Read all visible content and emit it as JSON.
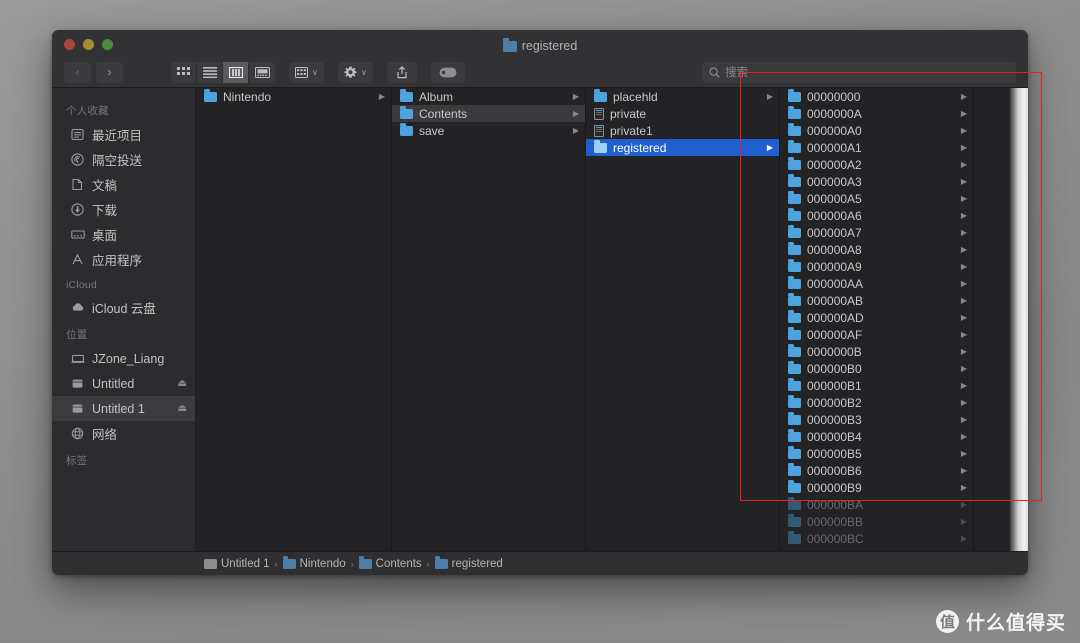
{
  "window": {
    "title": "registered",
    "title_icon": "folder-icon",
    "traffic_lights": [
      "close-button",
      "minimize-button",
      "zoom-button"
    ]
  },
  "toolbar": {
    "back_label": "‹",
    "forward_label": "›",
    "view_modes": [
      {
        "name": "icon-view",
        "active": false
      },
      {
        "name": "list-view",
        "active": false
      },
      {
        "name": "column-view",
        "active": true
      },
      {
        "name": "gallery-view",
        "active": false
      }
    ],
    "group_button": "grid-icon",
    "action_button": "gear-icon",
    "share_button": "share-icon",
    "tag_button": "tag-icon",
    "chevron": "∨"
  },
  "search": {
    "icon": "search-icon",
    "placeholder": "搜索",
    "value": ""
  },
  "sidebar": {
    "sections": [
      {
        "header": "个人收藏",
        "items": [
          {
            "label": "最近项目",
            "icon": "clock-recent-icon",
            "glyph": "☲",
            "selected": false,
            "eject": false
          },
          {
            "label": "隔空投送",
            "icon": "airdrop-icon",
            "glyph": "◎",
            "selected": false,
            "eject": false
          },
          {
            "label": "文稿",
            "icon": "documents-icon",
            "glyph": "☷",
            "selected": false,
            "eject": false
          },
          {
            "label": "下载",
            "icon": "downloads-icon",
            "glyph": "⬇",
            "selected": false,
            "eject": false
          },
          {
            "label": "桌面",
            "icon": "desktop-icon",
            "glyph": "▭",
            "selected": false,
            "eject": false
          },
          {
            "label": "应用程序",
            "icon": "applications-icon",
            "glyph": "Λ",
            "selected": false,
            "eject": false
          }
        ]
      },
      {
        "header": "iCloud",
        "items": [
          {
            "label": "iCloud 云盘",
            "icon": "cloud-icon",
            "glyph": "☁",
            "selected": false,
            "eject": false
          }
        ]
      },
      {
        "header": "位置",
        "items": [
          {
            "label": "JZone_Liang",
            "icon": "laptop-icon",
            "glyph": "▭",
            "selected": false,
            "eject": false
          },
          {
            "label": "Untitled",
            "icon": "drive-icon",
            "glyph": "▤",
            "selected": false,
            "eject": true
          },
          {
            "label": "Untitled 1",
            "icon": "drive-icon",
            "glyph": "▤",
            "selected": true,
            "eject": true
          },
          {
            "label": "网络",
            "icon": "network-globe-icon",
            "glyph": "⊕",
            "selected": false,
            "eject": false
          }
        ]
      },
      {
        "header": "标签",
        "items": []
      }
    ],
    "eject_glyph": "⏏"
  },
  "columns": [
    {
      "name": "column-volume",
      "rows": [
        {
          "label": "Nintendo",
          "kind": "folder",
          "arrow": true,
          "state": "none"
        }
      ]
    },
    {
      "name": "column-nintendo",
      "rows": [
        {
          "label": "Album",
          "kind": "folder",
          "arrow": true,
          "state": "none"
        },
        {
          "label": "Contents",
          "kind": "folder",
          "arrow": true,
          "state": "inactive"
        },
        {
          "label": "save",
          "kind": "folder",
          "arrow": true,
          "state": "none"
        }
      ]
    },
    {
      "name": "column-contents",
      "rows": [
        {
          "label": "placehld",
          "kind": "folder",
          "arrow": true,
          "state": "none"
        },
        {
          "label": "private",
          "kind": "file",
          "arrow": false,
          "state": "none"
        },
        {
          "label": "private1",
          "kind": "file",
          "arrow": false,
          "state": "none"
        },
        {
          "label": "registered",
          "kind": "folder",
          "arrow": true,
          "state": "active"
        }
      ]
    },
    {
      "name": "column-registered",
      "rows": [
        {
          "label": "00000000",
          "kind": "folder",
          "arrow": true,
          "state": "none",
          "dim": false
        },
        {
          "label": "0000000A",
          "kind": "folder",
          "arrow": true,
          "state": "none",
          "dim": false
        },
        {
          "label": "000000A0",
          "kind": "folder",
          "arrow": true,
          "state": "none",
          "dim": false
        },
        {
          "label": "000000A1",
          "kind": "folder",
          "arrow": true,
          "state": "none",
          "dim": false
        },
        {
          "label": "000000A2",
          "kind": "folder",
          "arrow": true,
          "state": "none",
          "dim": false
        },
        {
          "label": "000000A3",
          "kind": "folder",
          "arrow": true,
          "state": "none",
          "dim": false
        },
        {
          "label": "000000A5",
          "kind": "folder",
          "arrow": true,
          "state": "none",
          "dim": false
        },
        {
          "label": "000000A6",
          "kind": "folder",
          "arrow": true,
          "state": "none",
          "dim": false
        },
        {
          "label": "000000A7",
          "kind": "folder",
          "arrow": true,
          "state": "none",
          "dim": false
        },
        {
          "label": "000000A8",
          "kind": "folder",
          "arrow": true,
          "state": "none",
          "dim": false
        },
        {
          "label": "000000A9",
          "kind": "folder",
          "arrow": true,
          "state": "none",
          "dim": false
        },
        {
          "label": "000000AA",
          "kind": "folder",
          "arrow": true,
          "state": "none",
          "dim": false
        },
        {
          "label": "000000AB",
          "kind": "folder",
          "arrow": true,
          "state": "none",
          "dim": false
        },
        {
          "label": "000000AD",
          "kind": "folder",
          "arrow": true,
          "state": "none",
          "dim": false
        },
        {
          "label": "000000AF",
          "kind": "folder",
          "arrow": true,
          "state": "none",
          "dim": false
        },
        {
          "label": "0000000B",
          "kind": "folder",
          "arrow": true,
          "state": "none",
          "dim": false
        },
        {
          "label": "000000B0",
          "kind": "folder",
          "arrow": true,
          "state": "none",
          "dim": false
        },
        {
          "label": "000000B1",
          "kind": "folder",
          "arrow": true,
          "state": "none",
          "dim": false
        },
        {
          "label": "000000B2",
          "kind": "folder",
          "arrow": true,
          "state": "none",
          "dim": false
        },
        {
          "label": "000000B3",
          "kind": "folder",
          "arrow": true,
          "state": "none",
          "dim": false
        },
        {
          "label": "000000B4",
          "kind": "folder",
          "arrow": true,
          "state": "none",
          "dim": false
        },
        {
          "label": "000000B5",
          "kind": "folder",
          "arrow": true,
          "state": "none",
          "dim": false
        },
        {
          "label": "000000B6",
          "kind": "folder",
          "arrow": true,
          "state": "none",
          "dim": false
        },
        {
          "label": "000000B9",
          "kind": "folder",
          "arrow": true,
          "state": "none",
          "dim": false
        },
        {
          "label": "000000BA",
          "kind": "folder",
          "arrow": true,
          "state": "none",
          "dim": true
        },
        {
          "label": "000000BB",
          "kind": "folder",
          "arrow": true,
          "state": "none",
          "dim": true
        },
        {
          "label": "000000BC",
          "kind": "folder",
          "arrow": true,
          "state": "none",
          "dim": true
        }
      ]
    }
  ],
  "pathbar": {
    "crumbs": [
      {
        "label": "Untitled 1",
        "icon": "drive-icon"
      },
      {
        "label": "Nintendo",
        "icon": "folder-icon"
      },
      {
        "label": "Contents",
        "icon": "folder-icon"
      },
      {
        "label": "registered",
        "icon": "folder-icon"
      }
    ],
    "separator": "›"
  },
  "annotation": {
    "color": "#e8201f",
    "shape": "rectangle"
  },
  "watermark": {
    "badge": "值",
    "text": "什么值得买"
  }
}
